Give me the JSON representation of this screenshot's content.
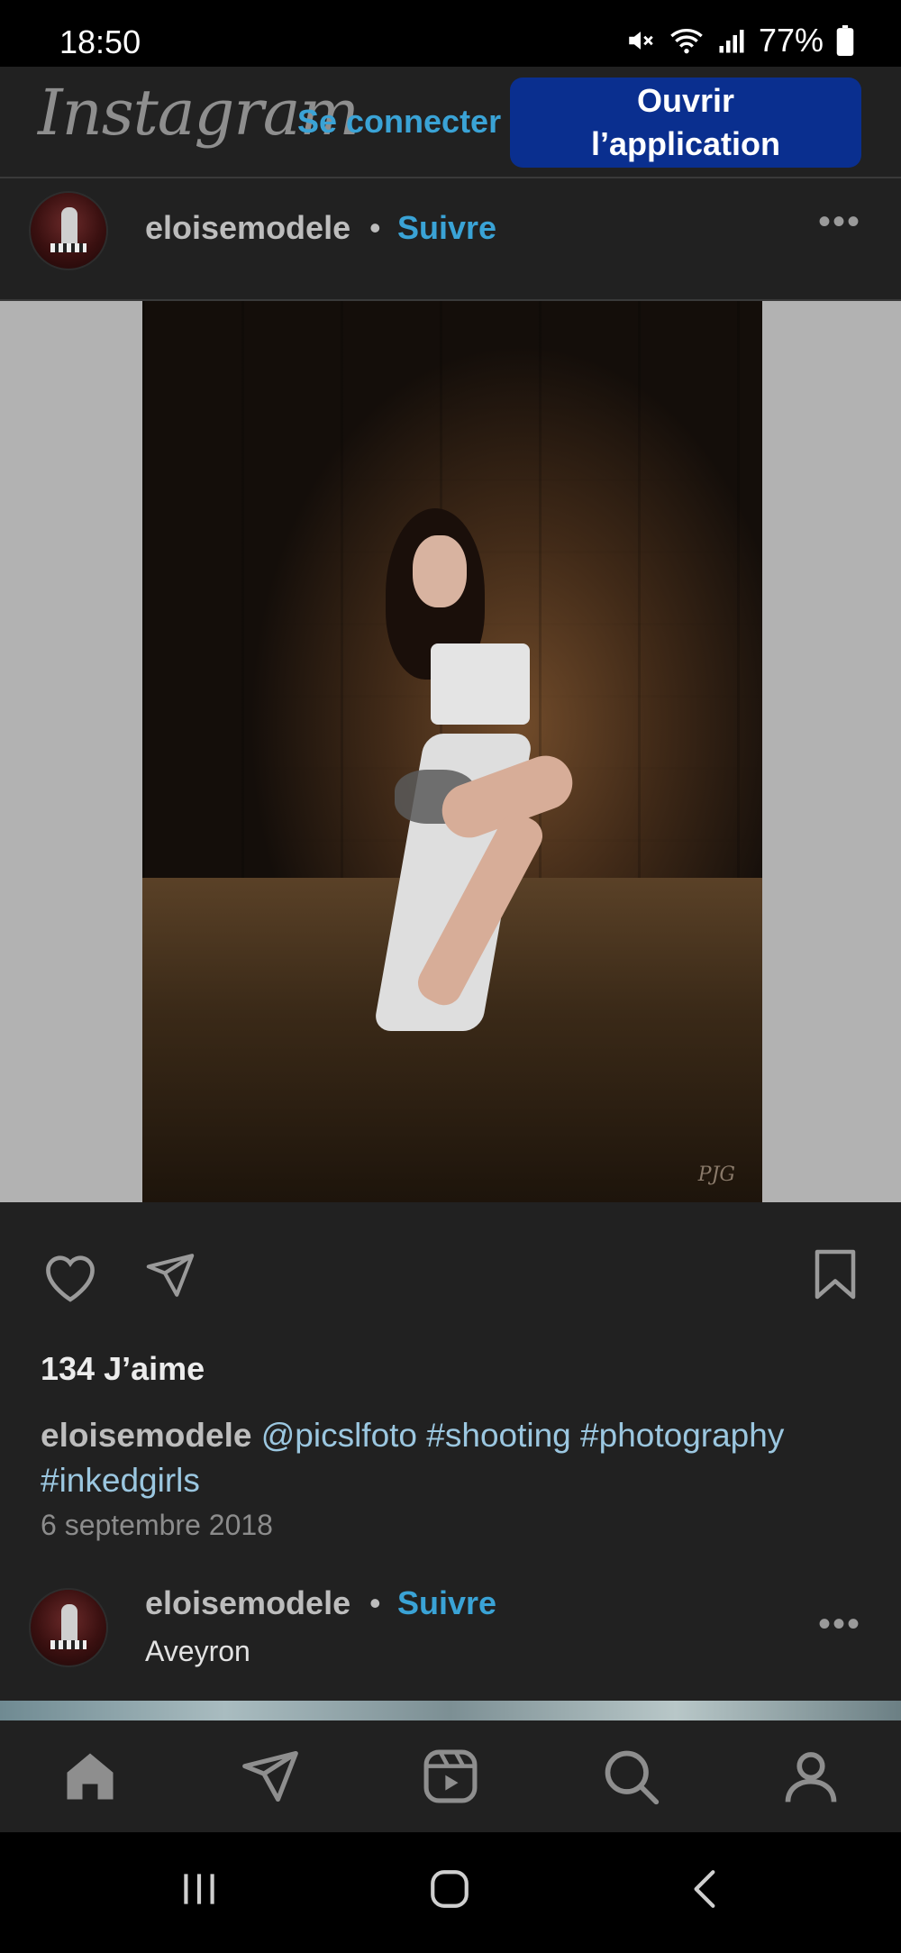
{
  "status_bar": {
    "time": "18:50",
    "battery": "77%",
    "icons": [
      "mute-icon",
      "wifi-icon",
      "signal-icon",
      "battery-icon"
    ]
  },
  "header": {
    "logo": "Instagram",
    "login_label": "Se connecter",
    "open_app_label_line1": "Ouvrir",
    "open_app_label_line2": "l’application"
  },
  "post": {
    "username": "eloisemodele",
    "separator": "•",
    "follow_label": "Suivre",
    "photo_signature": "PJG",
    "likes": "134 J’aime",
    "caption_user": "eloisemodele",
    "caption_text": "@picslfoto #shooting #photography #inkedgirls",
    "date": "6 septembre 2018"
  },
  "next_post": {
    "username": "eloisemodele",
    "separator": "•",
    "follow_label": "Suivre",
    "location": "Aveyron"
  },
  "bottom_nav": [
    "home-icon",
    "direct-icon",
    "reels-icon",
    "search-icon",
    "profile-icon"
  ],
  "colors": {
    "background": "#212121",
    "link": "#3aa3d6",
    "button": "#0a2f8f"
  }
}
